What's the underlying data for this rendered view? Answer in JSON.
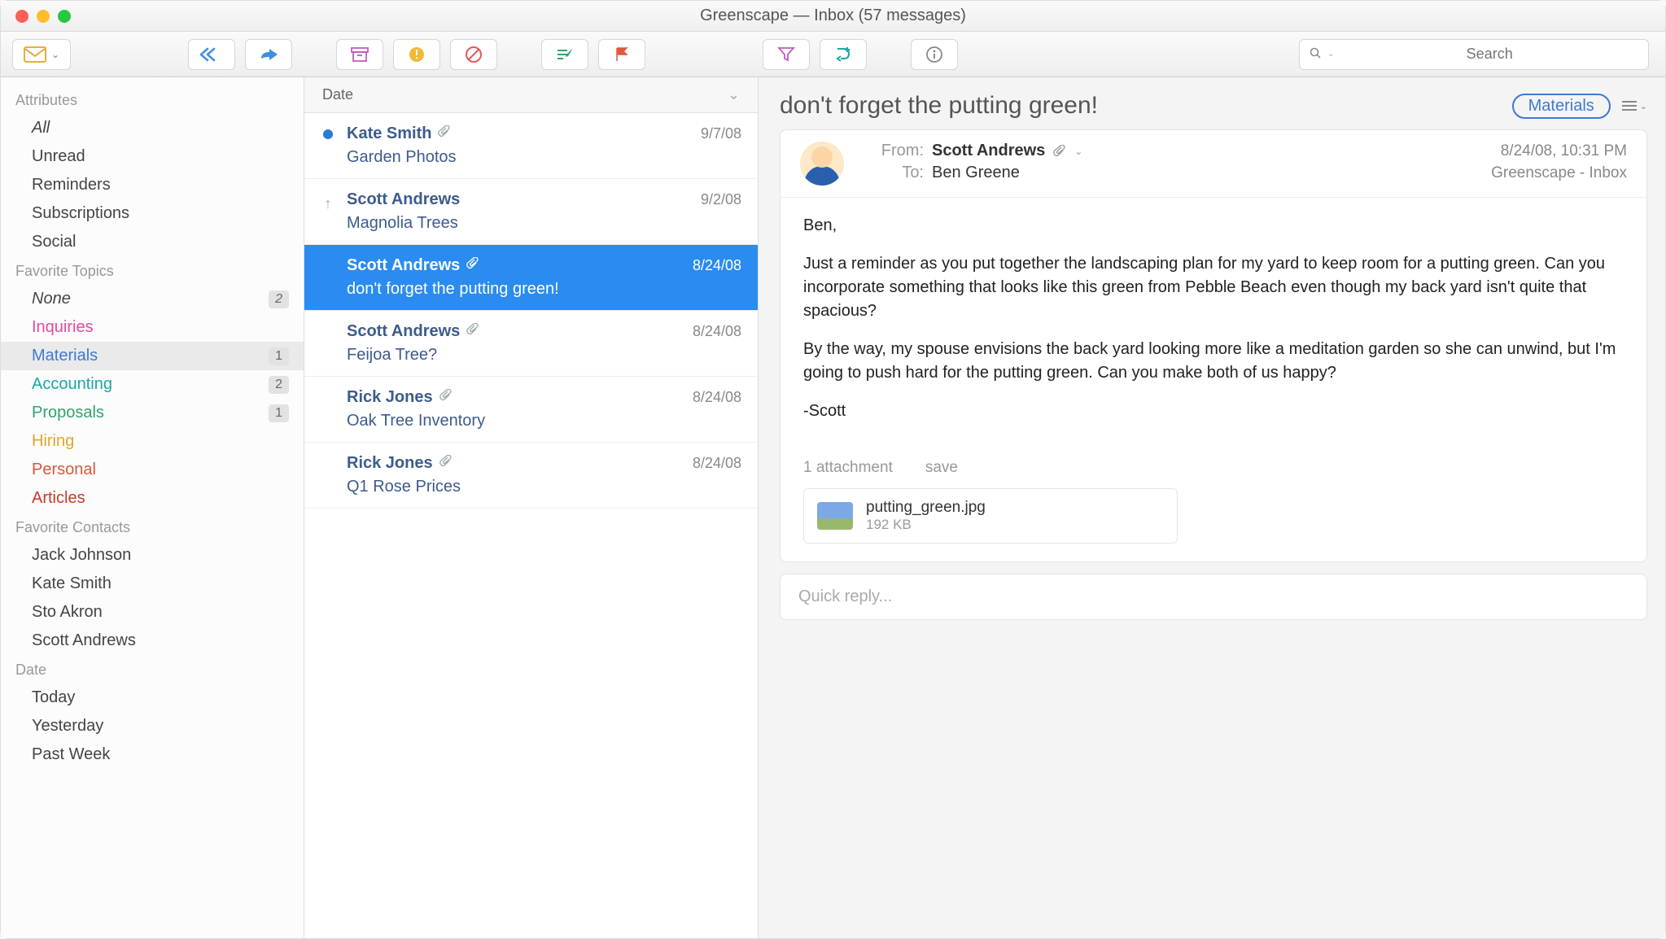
{
  "window": {
    "title": "Greenscape — Inbox (57 messages)"
  },
  "toolbar": {
    "search_placeholder": "Search"
  },
  "sidebar": {
    "attributes": {
      "header": "Attributes",
      "items": [
        {
          "label": "All",
          "italic": true
        },
        {
          "label": "Unread"
        },
        {
          "label": "Reminders"
        },
        {
          "label": "Subscriptions"
        },
        {
          "label": "Social"
        }
      ]
    },
    "topics": {
      "header": "Favorite Topics",
      "items": [
        {
          "label": "None",
          "italic": true,
          "count": "2"
        },
        {
          "label": "Inquiries",
          "color": "c-pink"
        },
        {
          "label": "Materials",
          "color": "c-blue",
          "count": "1",
          "selected": true
        },
        {
          "label": "Accounting",
          "color": "c-teal",
          "count": "2"
        },
        {
          "label": "Proposals",
          "color": "c-green",
          "count": "1"
        },
        {
          "label": "Hiring",
          "color": "c-orange"
        },
        {
          "label": "Personal",
          "color": "c-red"
        },
        {
          "label": "Articles",
          "color": "c-maroon"
        }
      ]
    },
    "contacts": {
      "header": "Favorite Contacts",
      "items": [
        {
          "label": "Jack Johnson"
        },
        {
          "label": "Kate Smith"
        },
        {
          "label": "Sto Akron"
        },
        {
          "label": "Scott Andrews"
        }
      ]
    },
    "dates": {
      "header": "Date",
      "items": [
        {
          "label": "Today"
        },
        {
          "label": "Yesterday"
        },
        {
          "label": "Past Week"
        }
      ]
    }
  },
  "messages": {
    "sort_label": "Date",
    "rows": [
      {
        "sender": "Kate Smith",
        "subject": "Garden Photos",
        "date": "9/7/08",
        "attachment": true,
        "indicator": "unread"
      },
      {
        "sender": "Scott Andrews",
        "subject": "Magnolia Trees",
        "date": "9/2/08",
        "attachment": false,
        "indicator": "reply"
      },
      {
        "sender": "Scott Andrews",
        "subject": "don't forget the putting green!",
        "date": "8/24/08",
        "attachment": true,
        "selected": true
      },
      {
        "sender": "Scott Andrews",
        "subject": "Feijoa Tree?",
        "date": "8/24/08",
        "attachment": true
      },
      {
        "sender": "Rick Jones",
        "subject": "Oak Tree Inventory",
        "date": "8/24/08",
        "attachment": true
      },
      {
        "sender": "Rick Jones",
        "subject": "Q1 Rose Prices",
        "date": "8/24/08",
        "attachment": true
      }
    ]
  },
  "reader": {
    "subject": "don't forget the putting green!",
    "tag": "Materials",
    "from_label": "From:",
    "to_label": "To:",
    "from": "Scott Andrews",
    "to": "Ben Greene",
    "timestamp": "8/24/08, 10:31 PM",
    "folder": "Greenscape - Inbox",
    "paragraphs": [
      "Ben,",
      "Just a reminder as you put together the landscaping plan for my yard to keep room for a putting green. Can you incorporate something that looks like this green from Pebble Beach even though my back yard isn't quite that spacious?",
      "By the way, my spouse envisions the back yard looking more like a meditation garden so she can unwind, but I'm going to push hard for the putting green. Can you make both of us happy?",
      "-Scott"
    ],
    "attachments": {
      "count_label": "1 attachment",
      "save_label": "save",
      "file": {
        "name": "putting_green.jpg",
        "size": "192 KB"
      }
    },
    "quick_reply_placeholder": "Quick reply..."
  }
}
